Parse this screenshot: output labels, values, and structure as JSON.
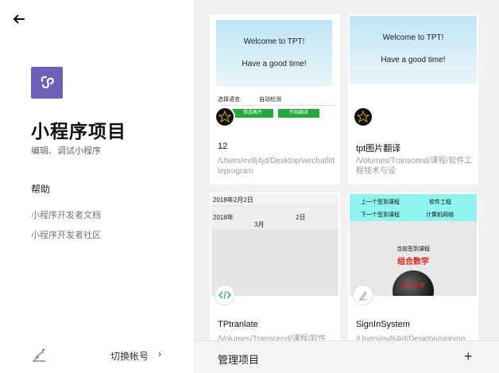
{
  "sidebar": {
    "back_icon": "arrow-left-icon",
    "title": "小程序项目",
    "subtitle": "编辑、调试小程序",
    "help_label": "帮助",
    "links": [
      "小程序开发者文档",
      "小程序开发者社区"
    ],
    "switch_account": "切换帐号",
    "chevron": "›",
    "brand_color": "#6c5fb8"
  },
  "projects": [
    {
      "name": "12",
      "path": "/Users/ev8j4jd/Desktop/wechatlittleprogram",
      "preview": {
        "welcome": "Welcome to TPT!",
        "good": "Have a good time!",
        "lang_label": "选择语言:",
        "lang_value": "自动检测",
        "btn1": "筛选图片",
        "btn2": "开始翻译"
      }
    },
    {
      "name": "tpt图片翻译",
      "path": "/Volumes/Transcend/课程/软件工程技术与设",
      "preview": {
        "welcome": "Welcome to TPT!",
        "good": "Have a good time!"
      }
    },
    {
      "name": "TPtranlate",
      "path": "/Volumes/Transcend/课程/软件",
      "preview": {
        "date_top": "2018年2月2日",
        "year": "2018年",
        "month": "3月",
        "day": "2日"
      }
    },
    {
      "name": "SignInSystem",
      "path": "/Users/ev8j4jd/Desktop/signing",
      "preview": {
        "prev_course": "上一个签到课程",
        "course1": "软件工程",
        "next_course": "下一个签到课程",
        "course2": "计算机网络",
        "current_course": "当前签到课程",
        "current_name": "组合数学",
        "button_text": "点 击 签 到"
      }
    }
  ],
  "bottom": {
    "manage_label": "管理项目",
    "add": "+"
  }
}
